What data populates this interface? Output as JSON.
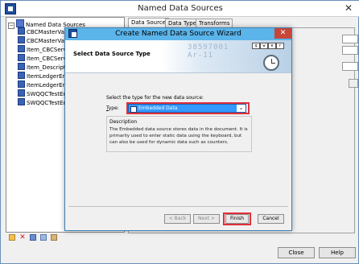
{
  "window": {
    "title": "Named Data Sources",
    "close_glyph": "✕"
  },
  "tree": {
    "root_label": "Named Data Sources",
    "expand_glyph": "−",
    "items": [
      "CBCMasterVariant_Description",
      "CBCMasterVariant",
      "Item_CBCServing",
      "Item_CBCServing",
      "Item_Description",
      "ItemLedgerEntry",
      "ItemLedgerEntry",
      "SWQQCTestEntry",
      "SWQQCTestEntry"
    ]
  },
  "tabs": [
    "Data Source",
    "Data Type",
    "Transforms"
  ],
  "buttons": {
    "close": "Close",
    "help": "Help"
  },
  "wizard": {
    "title": "Create Named Data Source Wizard",
    "close_glyph": "✕",
    "step_heading": "Select Data Source Type",
    "banner_digits": "38597001",
    "banner_digits_2": "Ar-11",
    "keys": [
      "q",
      "w",
      "e",
      "r"
    ],
    "prompt": "Select the type for the new data source:",
    "type_label": "Type:",
    "type_value": "Embedded Data",
    "dropdown_glyph": "⌄",
    "description_label": "Description",
    "description_text": "The Embedded data source stores data in the document.  It is primarily used to enter static data using the keyboard, but can also be used for dynamic data such as counters.",
    "back": "< Back",
    "next": "Next >",
    "finish": "Finish",
    "cancel": "Cancel"
  },
  "colors": {
    "title_bar": "#5bb4ea",
    "close_red": "#c7463a",
    "highlight_red": "#e0303a",
    "selection_blue": "#3399ff"
  },
  "icons": [
    "app-icon",
    "database-icon",
    "data-source-icon",
    "new-icon",
    "delete-icon",
    "cut-icon",
    "copy-icon",
    "paste-icon",
    "clock-icon",
    "keyboard-icon"
  ]
}
